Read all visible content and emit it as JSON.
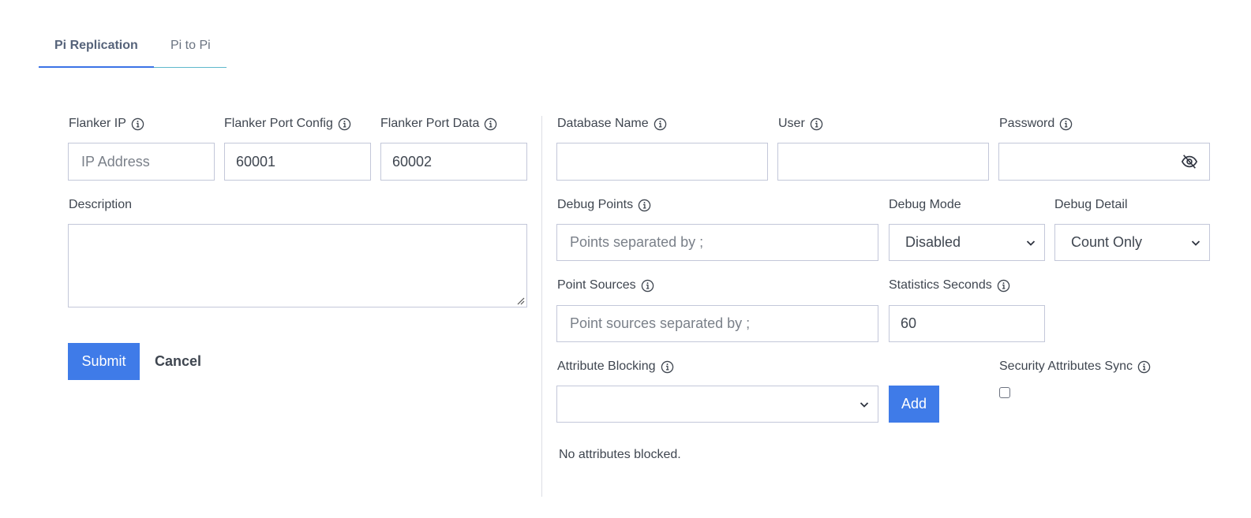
{
  "tabs": [
    {
      "label": "Pi Replication",
      "active": true
    },
    {
      "label": "Pi to Pi",
      "active": false
    }
  ],
  "left": {
    "flanker_ip": {
      "label": "Flanker IP",
      "value": "",
      "placeholder": "IP Address"
    },
    "flanker_port_config": {
      "label": "Flanker Port Config",
      "value": "60001"
    },
    "flanker_port_data": {
      "label": "Flanker Port Data",
      "value": "60002"
    },
    "description": {
      "label": "Description",
      "value": ""
    },
    "submit_label": "Submit",
    "cancel_label": "Cancel"
  },
  "right": {
    "database_name": {
      "label": "Database Name",
      "value": ""
    },
    "user": {
      "label": "User",
      "value": ""
    },
    "password": {
      "label": "Password",
      "value": ""
    },
    "debug_points": {
      "label": "Debug Points",
      "placeholder": "Points separated by ;"
    },
    "debug_mode": {
      "label": "Debug Mode",
      "selected": "Disabled"
    },
    "debug_detail": {
      "label": "Debug Detail",
      "selected": "Count Only"
    },
    "point_sources": {
      "label": "Point Sources",
      "placeholder": "Point sources separated by ;"
    },
    "statistics_seconds": {
      "label": "Statistics Seconds",
      "value": "60"
    },
    "attribute_blocking": {
      "label": "Attribute Blocking",
      "selected": ""
    },
    "add_label": "Add",
    "security_attributes_sync": {
      "label": "Security Attributes Sync",
      "checked": false
    },
    "no_attributes_text": "No attributes blocked."
  },
  "icons": {
    "info": "info-circle-icon",
    "eye": "eye-off-icon",
    "chevron": "chevron-down-icon"
  },
  "colors": {
    "accent": "#3f7be8",
    "tab_underline": "#3b73e6",
    "border": "#c3c7d9"
  }
}
